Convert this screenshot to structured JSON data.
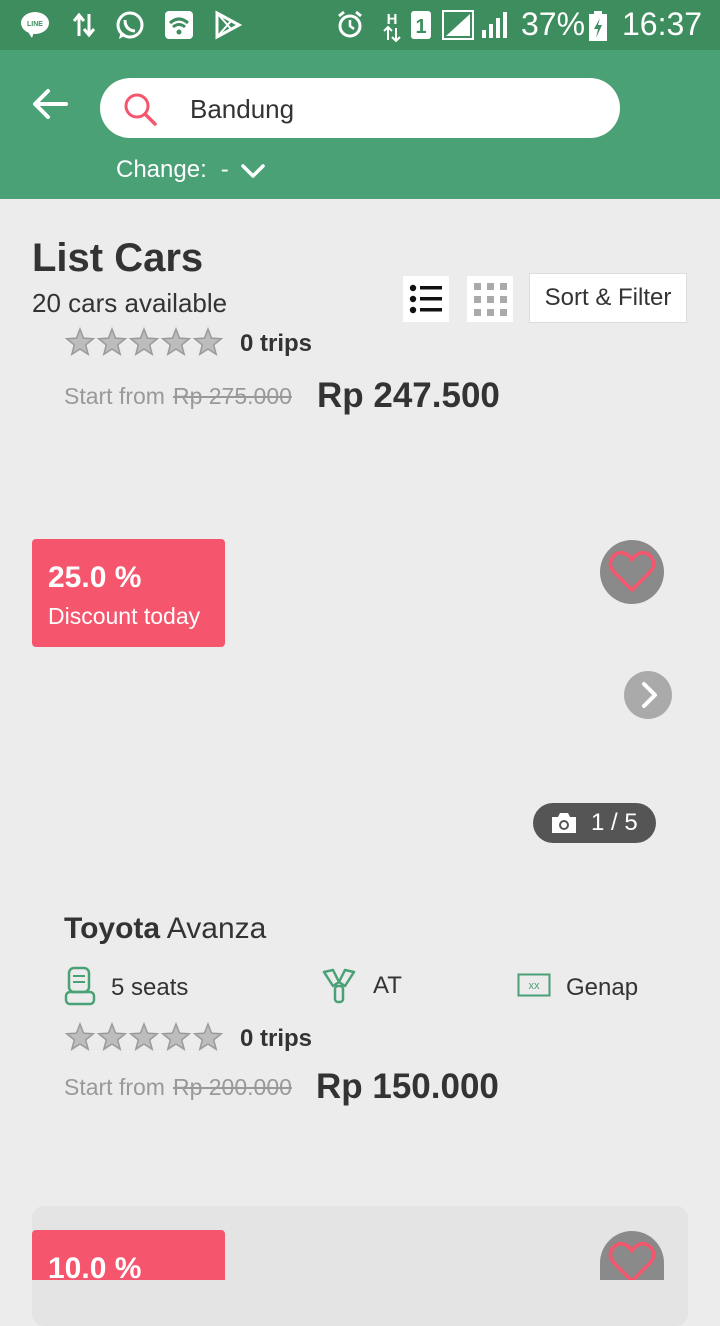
{
  "status_bar": {
    "battery": "37%",
    "time": "16:37",
    "icons": [
      "line-icon",
      "data-arrows-icon",
      "whatsapp-icon",
      "wifi-icon",
      "play-store-icon",
      "alarm-icon",
      "h-signal-icon",
      "sim1-icon",
      "signal-icon",
      "signal2-icon",
      "battery-charging-icon"
    ]
  },
  "header": {
    "search_value": "Bandung",
    "change_label": "Change:",
    "change_value": "-"
  },
  "list": {
    "title": "List Cars",
    "subtitle": "20 cars available",
    "sort_filter": "Sort & Filter"
  },
  "cards": [
    {
      "trips": "0 trips",
      "start_from": "Start from",
      "old_price": "Rp 275.000",
      "price": "Rp 247.500"
    },
    {
      "discount_pct": "25.0 %",
      "discount_text": "Discount today",
      "photo_count": "1 / 5",
      "brand": "Toyota",
      "model": "Avanza",
      "seats": "5 seats",
      "transmission": "AT",
      "plate": "Genap",
      "plate_icon_text": "xx",
      "rating_stars": 0,
      "trips": "0 trips",
      "start_from": "Start from",
      "old_price": "Rp 200.000",
      "price": "Rp 150.000"
    },
    {
      "discount_pct": "10.0 %"
    }
  ],
  "colors": {
    "status_bar": "#3d8d5e",
    "header": "#4aa176",
    "discount": "#f5566d",
    "heart": "#f5566d",
    "accent_green": "#4aa176"
  }
}
